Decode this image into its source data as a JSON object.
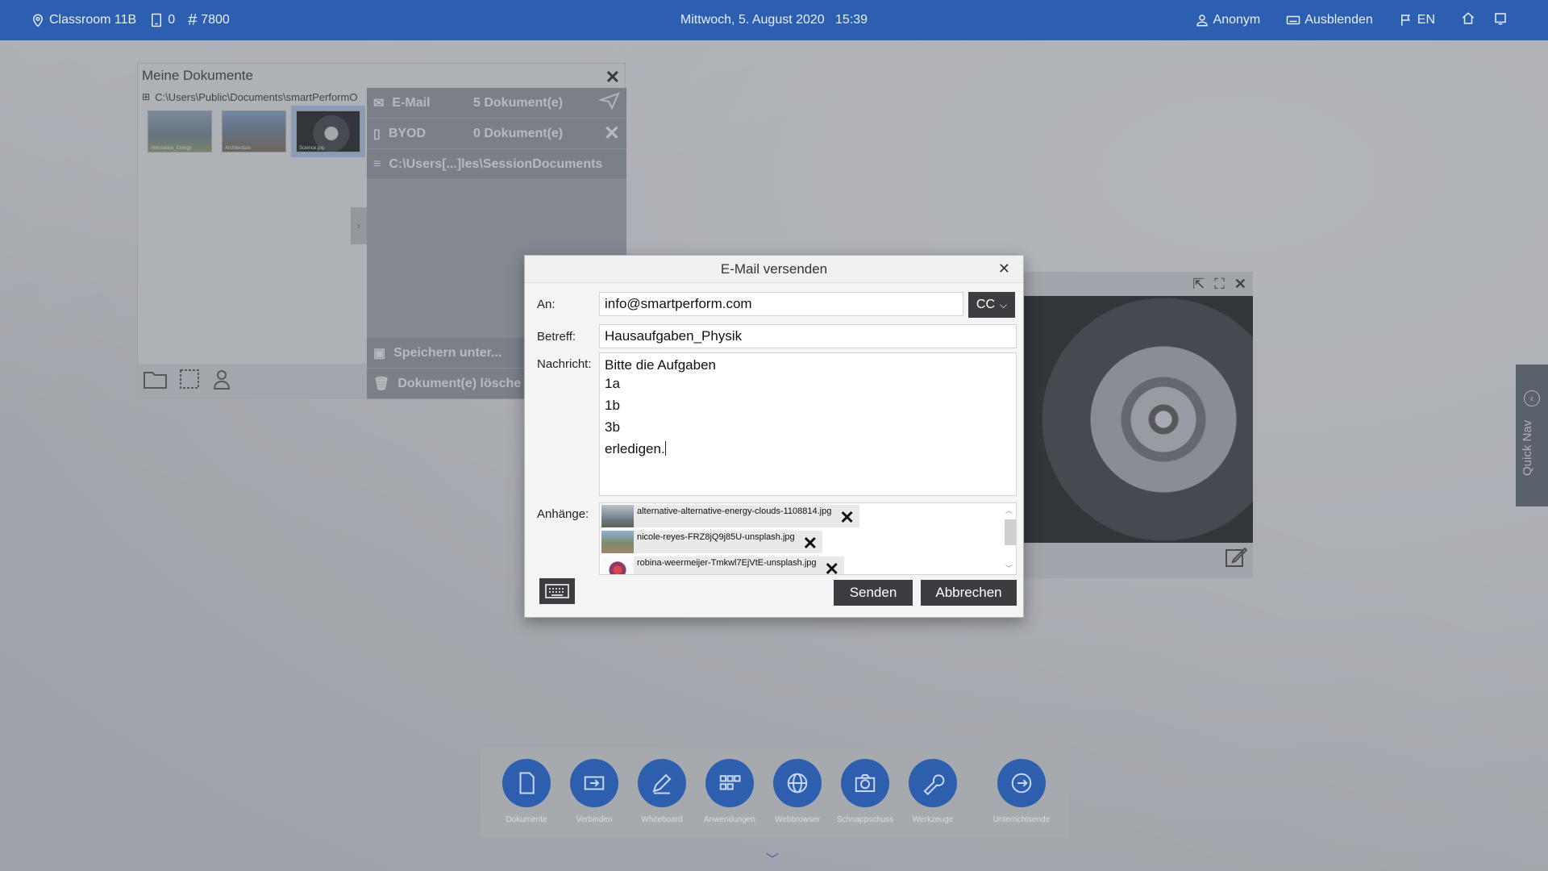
{
  "topbar": {
    "location": "Classroom 11B",
    "devices": "0",
    "session_code": "7800",
    "datetime": "Mittwoch, 5. August 2020   15:39",
    "user": "Anonym",
    "hide": "Ausblenden",
    "language": "EN"
  },
  "documents_window": {
    "title": "Meine Dokumente",
    "path": "C:\\Users\\Public\\Documents\\smartPerformO",
    "thumbnails": [
      "Alternative_Energy",
      "Architecture",
      "Science.jpg"
    ],
    "share": {
      "email_label": "E-Mail",
      "email_count": "5 Dokument(e)",
      "byod_label": "BYOD",
      "byod_count": "0 Dokument(e)",
      "session_path": "C:\\Users[...]les\\SessionDocuments",
      "save_as": "Speichern unter...",
      "delete": "Dokument(e) lösche"
    }
  },
  "dialog": {
    "title": "E-Mail versenden",
    "to_label": "An:",
    "to_value": "info@smartperform.com",
    "cc_label": "CC",
    "subject_label": "Betreff:",
    "subject_value": "Hausaufgaben_Physik",
    "message_label": "Nachricht:",
    "message_lines": [
      "Bitte die Aufgaben",
      "1a",
      "1b",
      "3b",
      "erledigen."
    ],
    "attachments_label": "Anhänge:",
    "attachments": [
      "alternative-alternative-energy-clouds-1108814.jpg",
      "nicole-reyes-FRZ8jQ9j85U-unsplash.jpg",
      "robina-weermeijer-Tmkwl7EjVtE-unsplash.jpg"
    ],
    "send": "Senden",
    "cancel": "Abbrechen"
  },
  "quicknav": {
    "label": "Quick Nav"
  },
  "dock": {
    "items": [
      "Dokumente",
      "Verbinden",
      "Whiteboard",
      "Anwendungen",
      "Webbrowser",
      "Schnappschuss",
      "Werkzeuge",
      "Unterrichtsende"
    ]
  },
  "colors": {
    "accent": "#2d5fb0",
    "dialog_button": "#3b3d40"
  }
}
